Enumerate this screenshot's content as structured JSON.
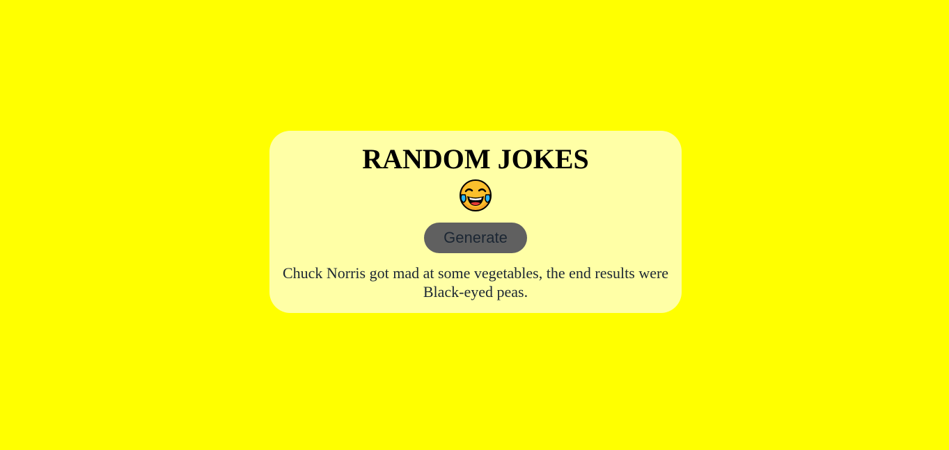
{
  "page": {
    "background_color": "#ffff00",
    "card_color": "#ffffa6"
  },
  "card": {
    "title": "RANDOM JOKES",
    "emoji_icon": "face-with-tears-of-joy-icon",
    "button": {
      "label": "Generate",
      "color": "#606060"
    },
    "joke_text": "Chuck Norris got mad at some vegetables, the end results were Black-eyed peas."
  }
}
